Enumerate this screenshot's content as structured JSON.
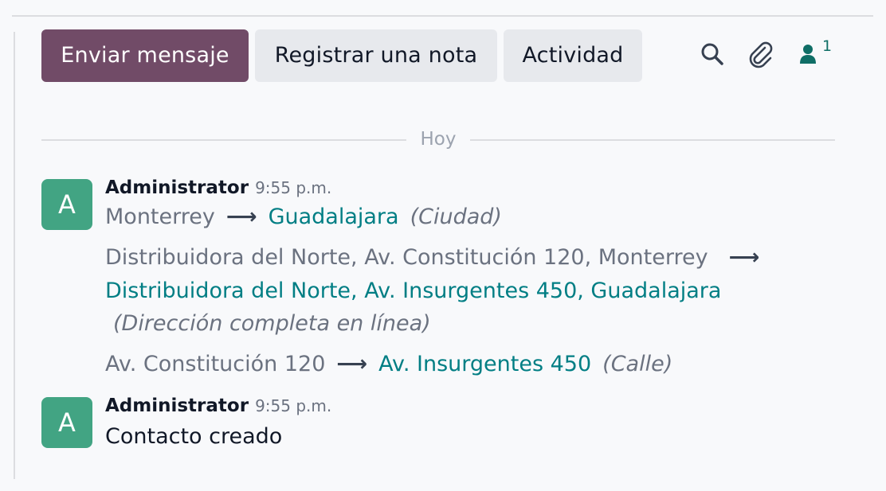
{
  "composer": {
    "send_message_label": "Enviar mensaje",
    "log_note_label": "Registrar una nota",
    "activity_label": "Actividad",
    "followers_count": "1"
  },
  "date_separator": "Hoy",
  "messages": [
    {
      "avatar_letter": "A",
      "author": "Administrator",
      "time": "9:55 p.m.",
      "tracking": [
        {
          "old": "Monterrey",
          "new": "Guadalajara",
          "field": "(Ciudad)"
        },
        {
          "old": "Distribuidora del Norte, Av. Constitución 120, Monterrey",
          "new": "Distribuidora del Norte, Av. Insurgentes 450, Guadalajara",
          "field": "(Dirección completa en línea)"
        },
        {
          "old": "Av. Constitución 120",
          "new": "Av. Insurgentes 450",
          "field": "(Calle)"
        }
      ]
    },
    {
      "avatar_letter": "A",
      "author": "Administrator",
      "time": "9:55 p.m.",
      "body": "Contacto creado"
    }
  ],
  "icons": {
    "search": "search-icon",
    "attachment": "paperclip-icon",
    "followers": "user-icon"
  },
  "colors": {
    "primary": "#714b67",
    "avatar": "#42a483",
    "link": "#017e84"
  }
}
